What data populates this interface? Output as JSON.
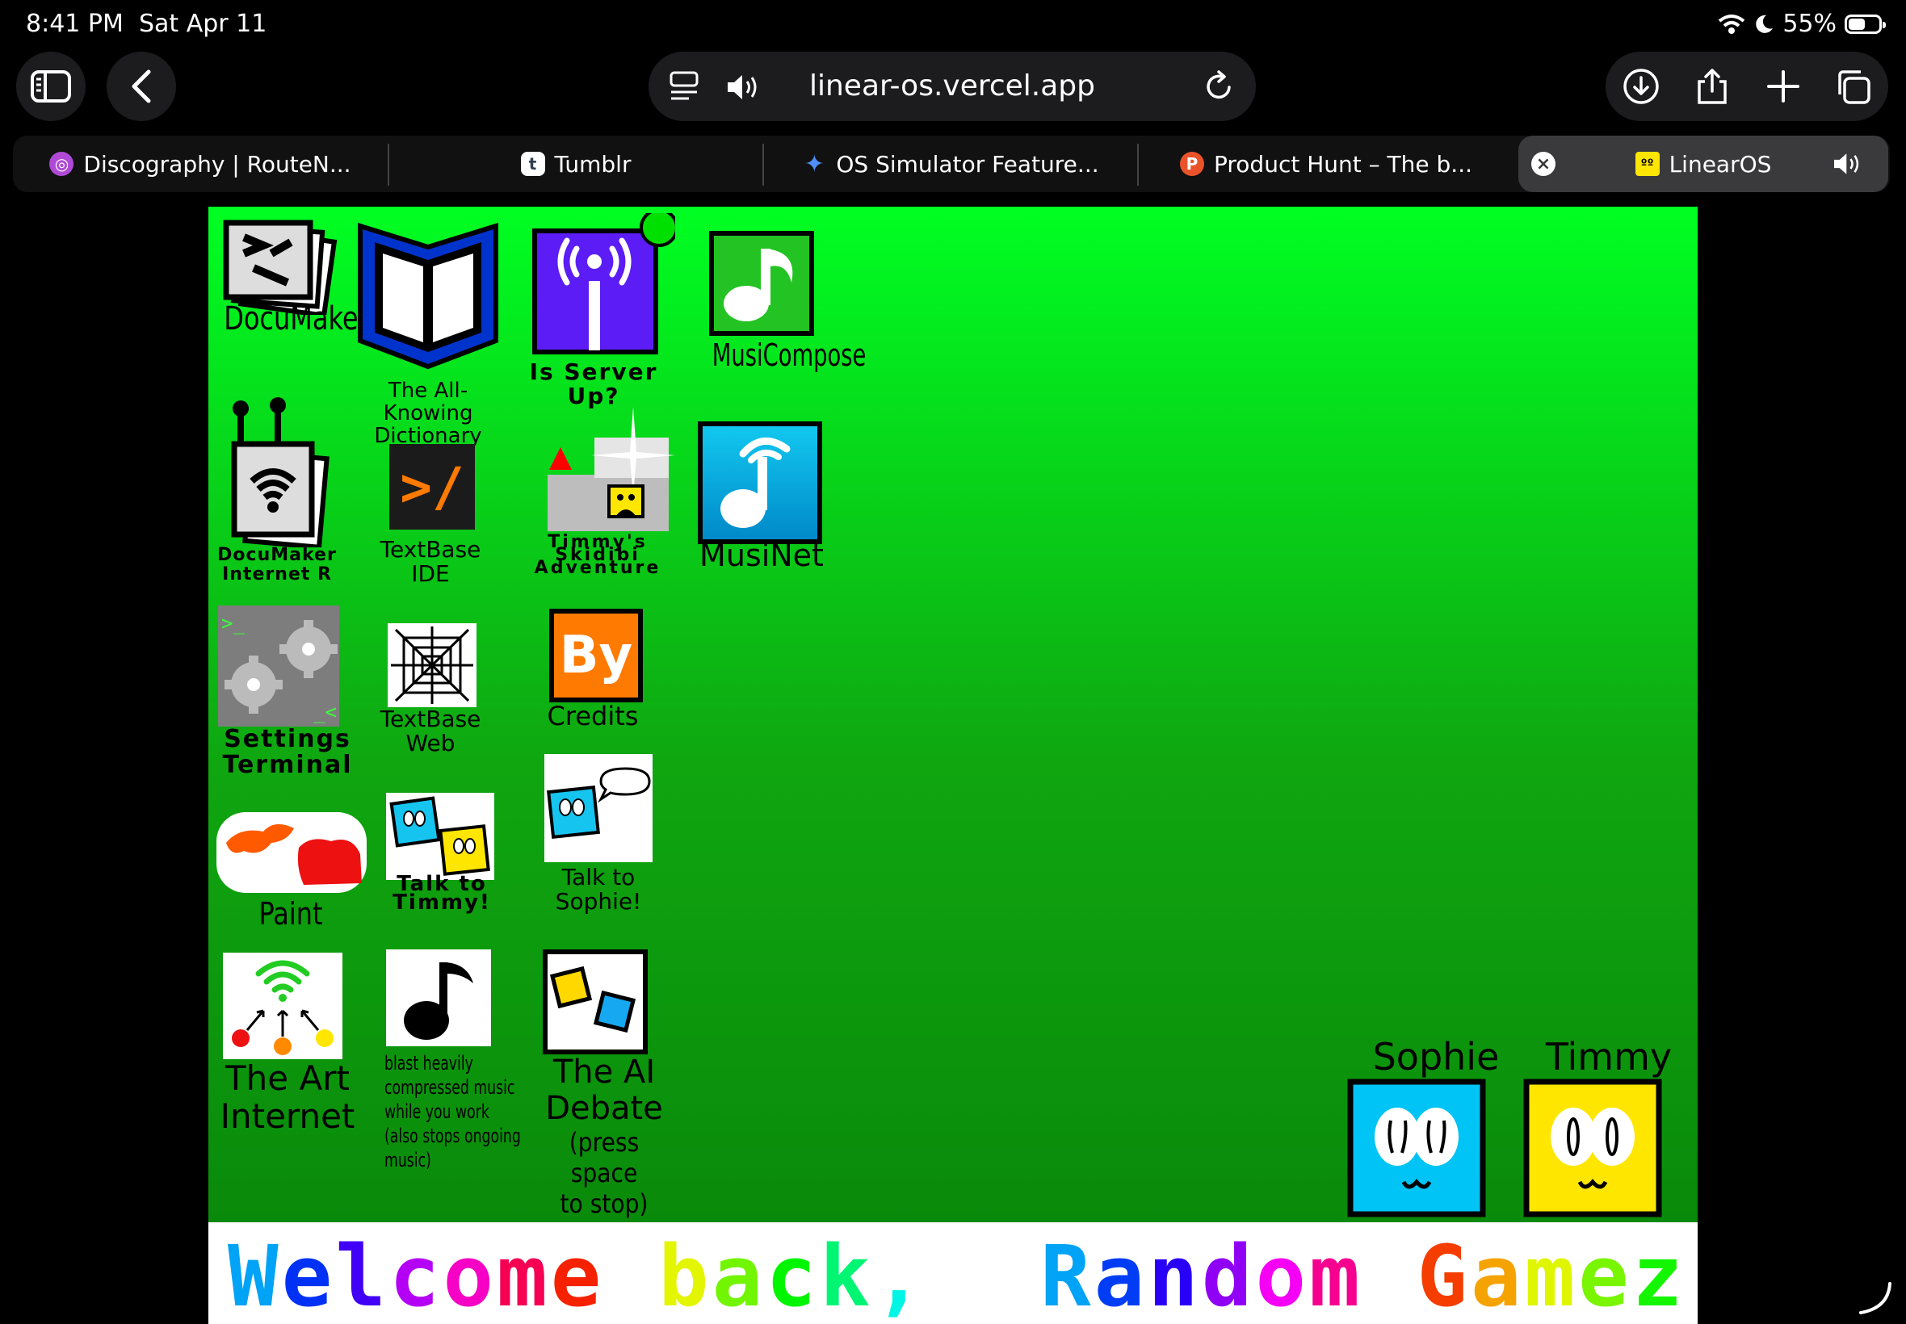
{
  "status_bar": {
    "time": "8:41 PM",
    "date": "Sat Apr 11",
    "battery": "55%",
    "battery_level": 0.55
  },
  "toolbar": {
    "url": "linear-os.vercel.app"
  },
  "tabs": [
    {
      "label": "Discography | RouteN...",
      "icon": "routenote-icon",
      "color": "#b04ad6"
    },
    {
      "label": "Tumblr",
      "icon": "tumblr-icon",
      "color": "#2d3e50"
    },
    {
      "label": "OS Simulator Feature...",
      "icon": "gemini-sparkle-icon",
      "color": "#4f8ef7"
    },
    {
      "label": "Product Hunt – The b...",
      "icon": "product-hunt-icon",
      "color": "#ea532a"
    },
    {
      "label": "LinearOS",
      "icon": "linearos-icon",
      "color": "#ffe600",
      "active": true
    }
  ],
  "desktop": {
    "apps": {
      "documaker": "DocuMaker",
      "dictionary_1": "The All-Knowing",
      "dictionary_2": "Dictionary",
      "server_1": "Is Server",
      "server_2": "Up?",
      "musicompose": "MusiCompose",
      "docinternet_1": "DocuMaker",
      "docinternet_2": "Internet R",
      "textbase_ide_1": "TextBase",
      "textbase_ide_2": "IDE",
      "skibidi_1": "Timmy's",
      "skibidi_2": "Skidibi",
      "skibidi_3": "Adventure",
      "musinet": "MusiNet",
      "settings_1": "Settings",
      "settings_2": "Terminal",
      "textbase_web_1": "TextBase",
      "textbase_web_2": "Web",
      "credits": "Credits",
      "paint": "Paint",
      "timmy_1": "Talk to",
      "timmy_2": "Timmy!",
      "sophie_1": "Talk to",
      "sophie_2": "Sophie!",
      "art_1": "The Art",
      "art_2": "Internet",
      "blast_1": "blast heavily",
      "blast_2": "compressed music",
      "blast_3": "while you work",
      "blast_4": "(also stops ongoing",
      "blast_5": "music)",
      "debate_1": "The AI",
      "debate_2": "Debate",
      "debate_3": "(press space",
      "debate_4": "to stop)"
    },
    "textbase_ide_glyph": ">/",
    "credits_glyph": "By",
    "companions": {
      "sophie": "Sophie",
      "timmy": "Timmy"
    }
  },
  "taskbar": {
    "welcome": "Welcome back,",
    "username": "Random Gamez J"
  }
}
